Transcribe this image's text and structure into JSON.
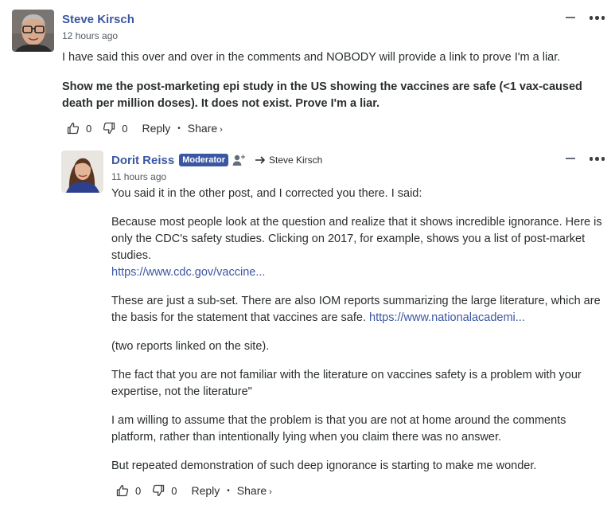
{
  "comments": [
    {
      "author": "Steve Kirsch",
      "timestamp": "12 hours ago",
      "paragraphs": [
        "I have said this over and over in the comments and NOBODY will provide a link to prove I'm a liar.",
        "Show me the post-marketing epi study in the US showing the vaccines are safe (<1 vax-caused death per million doses). It does not exist. Prove I'm a liar."
      ],
      "upvotes": "0",
      "downvotes": "0",
      "reply_label": "Reply",
      "share_label": "Share",
      "share_chevron": "›"
    },
    {
      "author": "Dorit Reiss",
      "badge": "Moderator",
      "reply_to": "Steve Kirsch",
      "timestamp": "11 hours ago",
      "paragraph1": "You said it in the other post, and I corrected you there. I said:",
      "paragraph2_text": "Because most people look at the question and realize that it shows incredible ignorance. Here is only the CDC's safety studies. Clicking on 2017, for example, shows you a list of post-market studies.",
      "paragraph2_link": "https://www.cdc.gov/vaccine...",
      "paragraph3_text": "These are just a sub-set. There are also IOM reports summarizing the large literature, which are the basis for the statement that vaccines are safe.",
      "paragraph3_link": "https://www.nationalacademi...",
      "paragraph4": "(two reports linked on the site).",
      "paragraph5": "The fact that you are not familiar with the literature on vaccines safety is a problem with your expertise, not the literature\"",
      "paragraph6": "I am willing to assume that the problem is that you are not at home around the comments platform, rather than intentionally lying when you claim there was no answer.",
      "paragraph7": "But repeated demonstration of such deep ignorance is starting to make me wonder.",
      "upvotes": "0",
      "downvotes": "0",
      "reply_label": "Reply",
      "share_label": "Share",
      "share_chevron": "›"
    }
  ],
  "separator": "•",
  "colors": {
    "link": "#3b57a3",
    "badge_bg": "#3b57a3",
    "text": "#2a2e2e",
    "meta": "#535b63"
  }
}
